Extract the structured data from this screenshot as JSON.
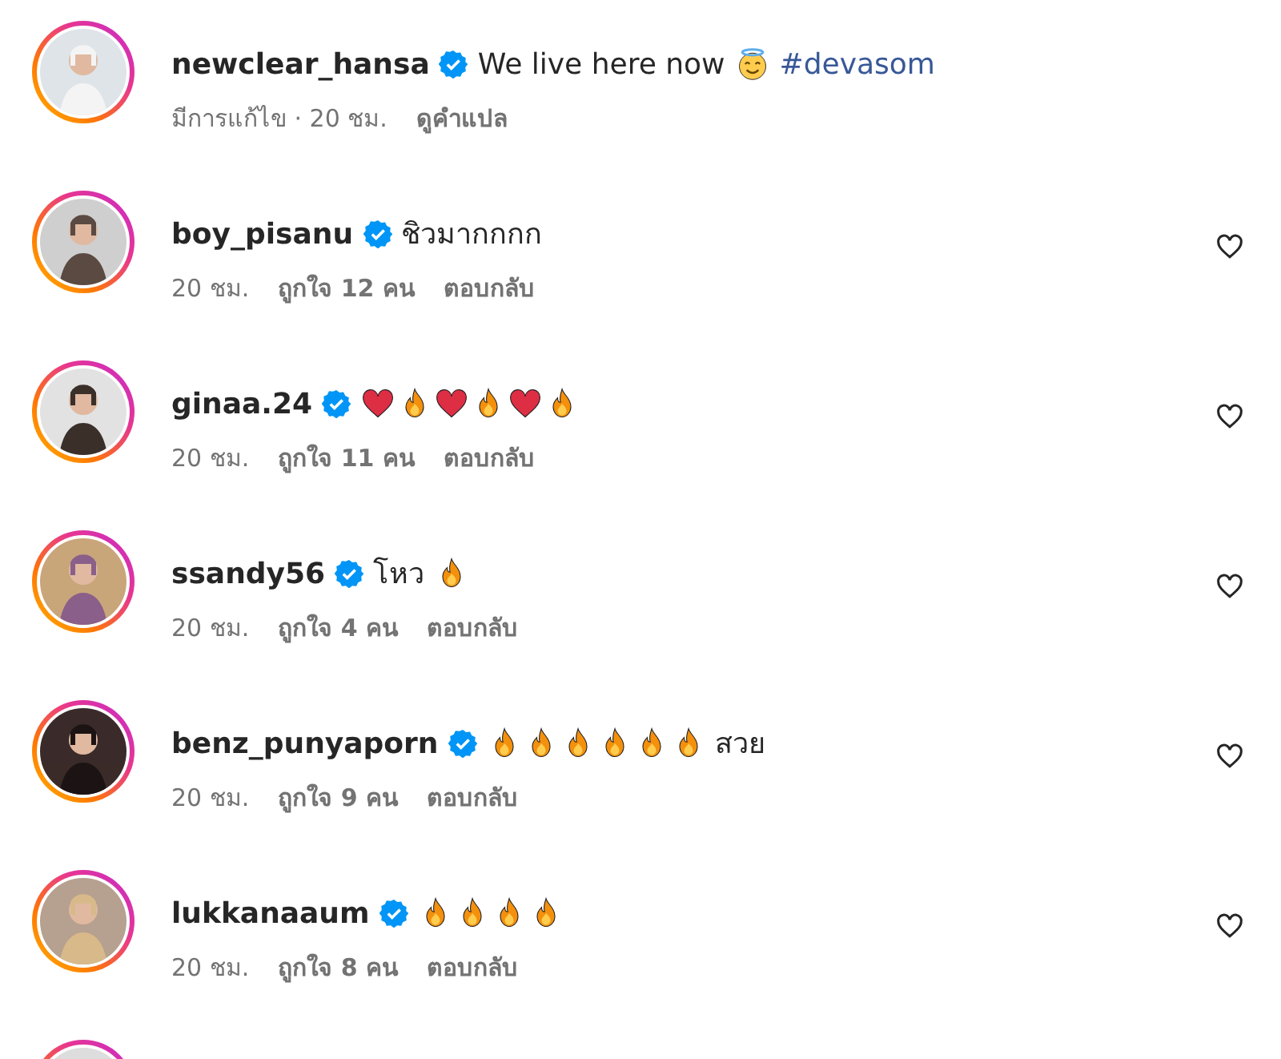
{
  "comments": [
    {
      "avatar": {
        "kind": "picture"
      },
      "username": "newclear_hansa",
      "verified": true,
      "parts": [
        {
          "kind": "text",
          "text": "We live here now"
        },
        {
          "kind": "halo"
        },
        {
          "kind": "hashtag",
          "text": "#devasom"
        }
      ],
      "meta": [
        {
          "text": "มีการแก้ไข · 20 ชม.",
          "bold": false
        },
        {
          "text": "ดูคำแปล",
          "bold": true
        }
      ]
    },
    {
      "avatar": {
        "kind": "picture"
      },
      "username": "boy_pisanu",
      "verified": true,
      "parts": [
        {
          "kind": "text",
          "text": "ชิวมากกกก"
        }
      ],
      "meta": [
        {
          "text": "20 ชม.",
          "bold": false
        },
        {
          "text": "ถูกใจ 12 คน",
          "bold": true
        },
        {
          "text": "ตอบกลับ",
          "bold": true
        }
      ],
      "liked": false
    },
    {
      "avatar": {
        "kind": "picture"
      },
      "username": "ginaa.24",
      "verified": true,
      "parts": [
        {
          "kind": "heart"
        },
        {
          "kind": "fire"
        },
        {
          "kind": "heart"
        },
        {
          "kind": "fire"
        },
        {
          "kind": "heart"
        },
        {
          "kind": "fire"
        }
      ],
      "meta": [
        {
          "text": "20 ชม.",
          "bold": false
        },
        {
          "text": "ถูกใจ 11 คน",
          "bold": true
        },
        {
          "text": "ตอบกลับ",
          "bold": true
        }
      ],
      "liked": false
    },
    {
      "avatar": {
        "kind": "picture"
      },
      "username": "ssandy56",
      "verified": true,
      "parts": [
        {
          "kind": "text",
          "text": "โหว"
        },
        {
          "kind": "fire"
        }
      ],
      "meta": [
        {
          "text": "20 ชม.",
          "bold": false
        },
        {
          "text": "ถูกใจ 4 คน",
          "bold": true
        },
        {
          "text": "ตอบกลับ",
          "bold": true
        }
      ],
      "liked": false
    },
    {
      "avatar": {
        "kind": "picture"
      },
      "username": "benz_punyaporn",
      "verified": true,
      "parts": [
        {
          "kind": "fire"
        },
        {
          "kind": "fire"
        },
        {
          "kind": "fire"
        },
        {
          "kind": "fire"
        },
        {
          "kind": "fire"
        },
        {
          "kind": "fire"
        },
        {
          "kind": "text",
          "text": "สวย"
        }
      ],
      "meta": [
        {
          "text": "20 ชม.",
          "bold": false
        },
        {
          "text": "ถูกใจ 9 คน",
          "bold": true
        },
        {
          "text": "ตอบกลับ",
          "bold": true
        }
      ],
      "liked": false
    },
    {
      "avatar": {
        "kind": "picture"
      },
      "username": "lukkanaaum",
      "verified": true,
      "parts": [
        {
          "kind": "fire"
        },
        {
          "kind": "fire"
        },
        {
          "kind": "fire"
        },
        {
          "kind": "fire"
        }
      ],
      "meta": [
        {
          "text": "20 ชม.",
          "bold": false
        },
        {
          "text": "ถูกใจ 8 คน",
          "bold": true
        },
        {
          "text": "ตอบกลับ",
          "bold": true
        }
      ],
      "liked": false
    },
    {
      "avatar": {
        "kind": "picture"
      }
    }
  ]
}
